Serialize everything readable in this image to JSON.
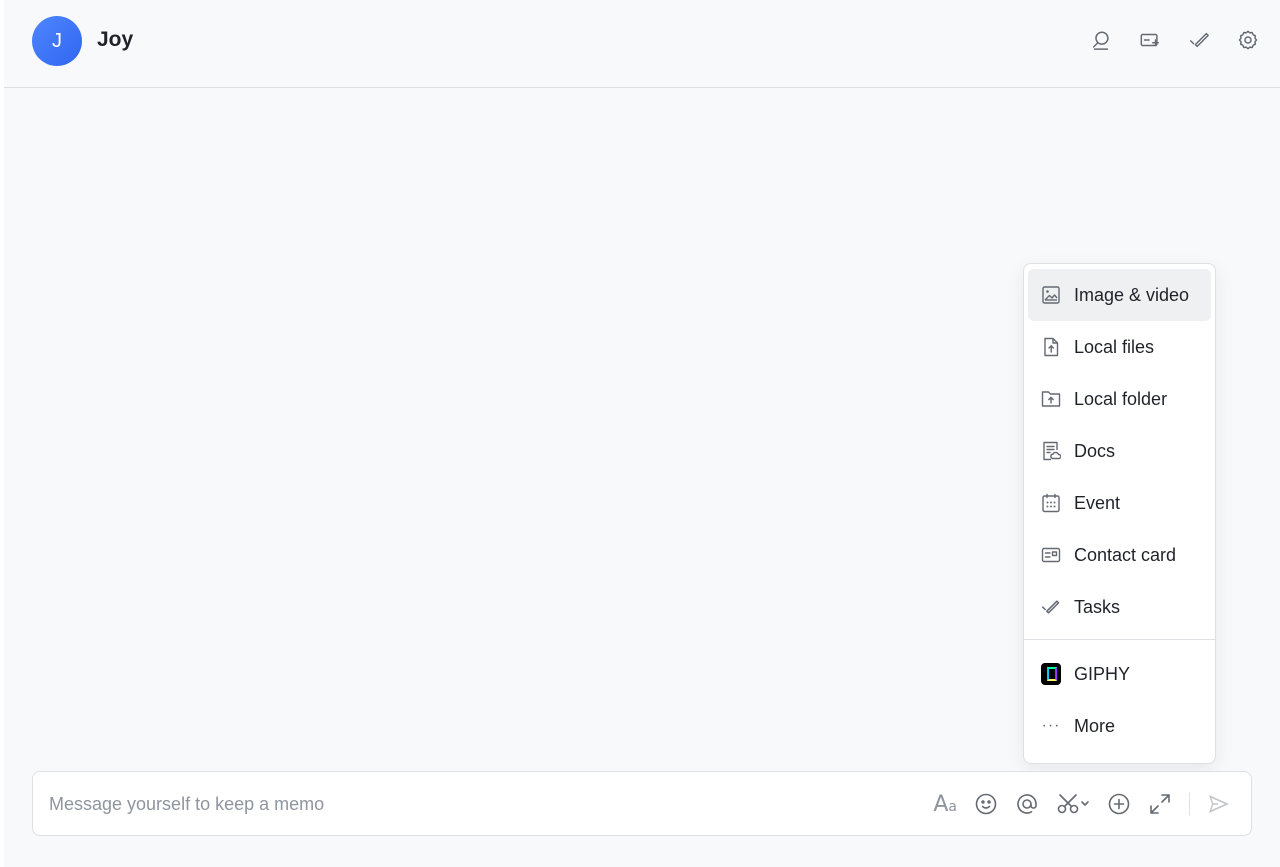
{
  "header": {
    "avatar_initial": "J",
    "title": "Joy",
    "actions": [
      {
        "name": "search-icon"
      },
      {
        "name": "add-tab-icon"
      },
      {
        "name": "tasks-icon"
      },
      {
        "name": "settings-icon"
      }
    ]
  },
  "menu": {
    "items": [
      {
        "label": "Image & video",
        "icon": "image-icon",
        "active": true
      },
      {
        "label": "Local files",
        "icon": "file-upload-icon"
      },
      {
        "label": "Local folder",
        "icon": "folder-upload-icon"
      },
      {
        "label": "Docs",
        "icon": "docs-icon"
      },
      {
        "label": "Event",
        "icon": "calendar-icon"
      },
      {
        "label": "Contact card",
        "icon": "contact-card-icon"
      },
      {
        "label": "Tasks",
        "icon": "tasks-icon"
      }
    ],
    "extra_items": [
      {
        "label": "GIPHY",
        "icon": "giphy-icon"
      },
      {
        "label": "More",
        "icon": "more-icon",
        "glyph": "···"
      }
    ]
  },
  "composer": {
    "placeholder": "Message yourself to keep a memo",
    "value": "",
    "format_glyph": "A",
    "format_glyph_small": "a"
  },
  "colors": {
    "accent": "#3370ff",
    "background": "#f8f9fb",
    "border": "#dee0e3",
    "icon": "#646a73"
  }
}
